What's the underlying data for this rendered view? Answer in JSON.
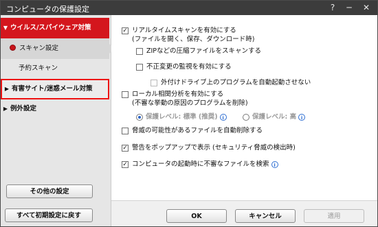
{
  "window": {
    "title": "コンピュータの保護設定",
    "help": "?",
    "minimize": "─",
    "close": "✕"
  },
  "sidebar": {
    "items": [
      {
        "label": "ウイルス/スパイウェア対策",
        "glyph": "▼"
      },
      {
        "label": "スキャン設定"
      },
      {
        "label": "予約スキャン"
      },
      {
        "label": "有害サイト/迷惑メール対策",
        "glyph": "▶"
      },
      {
        "label": "例外設定",
        "glyph": "▶"
      }
    ],
    "other_settings": "その他の設定"
  },
  "options": [
    {
      "label": "リアルタイムスキャンを有効にする",
      "checked": true,
      "glyph": "✓"
    },
    {
      "label": "(ファイルを開く、保存、ダウンロード時)"
    },
    {
      "label": "ZIPなどの圧縮ファイルをスキャンする",
      "checked": false
    },
    {
      "label": "不正変更の監視を有効にする",
      "checked": false
    },
    {
      "label": "外付けドライブ上のプログラムを自動起動させない",
      "checked": false,
      "disabled": true
    },
    {
      "label": "ローカル相関分析を有効にする",
      "checked": false
    },
    {
      "label": "(不審な挙動の原因のプログラムを削除)"
    },
    {
      "label": "保護レベル: 標準 (推奨)",
      "selected": true
    },
    {
      "label": "保護レベル: 高",
      "selected": false
    },
    {
      "label": "脅威の可能性があるファイルを自動削除する",
      "checked": false
    },
    {
      "label": "警告をポップアップで表示 (セキュリティ脅威の検出時)",
      "checked": true,
      "glyph": "✓"
    },
    {
      "label": "コンピュータの起動時に不審なファイルを検索",
      "checked": true,
      "glyph": "✓"
    }
  ],
  "info_glyph": "i",
  "buttons": {
    "reset": "すべて初期設定に戻す",
    "ok": "OK",
    "cancel": "キャンセル",
    "apply": "適用"
  },
  "colors": {
    "accent": "#d4161d",
    "titlebar": "#3c3c3c",
    "info": "#2f6fd2"
  }
}
